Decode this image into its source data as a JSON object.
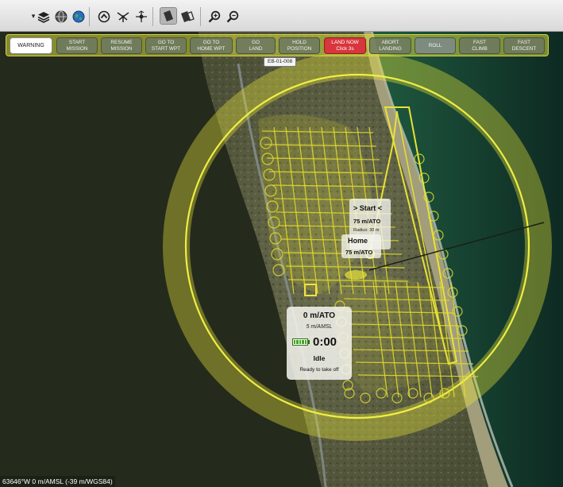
{
  "toolbar": {
    "icons": [
      "dropdown-arrow",
      "layers-icon",
      "globe-dark-icon",
      "globe-blue-icon",
      "home-arrow-icon",
      "mission-plan-icon",
      "center-drone-icon",
      "tile-single-icon",
      "tile-multi-icon",
      "zoom-in-icon",
      "zoom-out-icon"
    ]
  },
  "commands": [
    {
      "label": "WARNING"
    },
    {
      "label": "START\nMISSION"
    },
    {
      "label": "RESUME\nMISSION"
    },
    {
      "label": "GO TO\nSTART WPT"
    },
    {
      "label": "GO TO\nHOME WPT"
    },
    {
      "label": "GO\nLAND"
    },
    {
      "label": "HOLD\nPOSITION"
    },
    {
      "label": "LAND NOW\nClick 3s"
    },
    {
      "label": "ABORT\nLANDING"
    },
    {
      "label": "ROLL"
    },
    {
      "label": "FAST\nCLIMB"
    },
    {
      "label": "FAST\nDESCENT"
    }
  ],
  "map": {
    "mission_id": "EB-01-008",
    "start_wp": {
      "title": "> Start <",
      "altitude": "75 m/ATO",
      "radius": "Radius: 30 m"
    },
    "home_wp": {
      "title": "Home",
      "altitude": "75 m/ATO"
    },
    "status": {
      "altitude": "0 m/ATO",
      "amsl": "5 m/AMSL",
      "battery_level": 1.0,
      "timer": "0:00",
      "state": "Idle",
      "ready": "Ready to take off"
    },
    "coordinate_readout": "63646°W 0 m/AMSL (-39 m/WGS84)"
  },
  "colors": {
    "flight_path": "#e3dc2e",
    "geofence": "#ecec38",
    "alert_button": "#d8353c",
    "battery": "#43a322"
  }
}
